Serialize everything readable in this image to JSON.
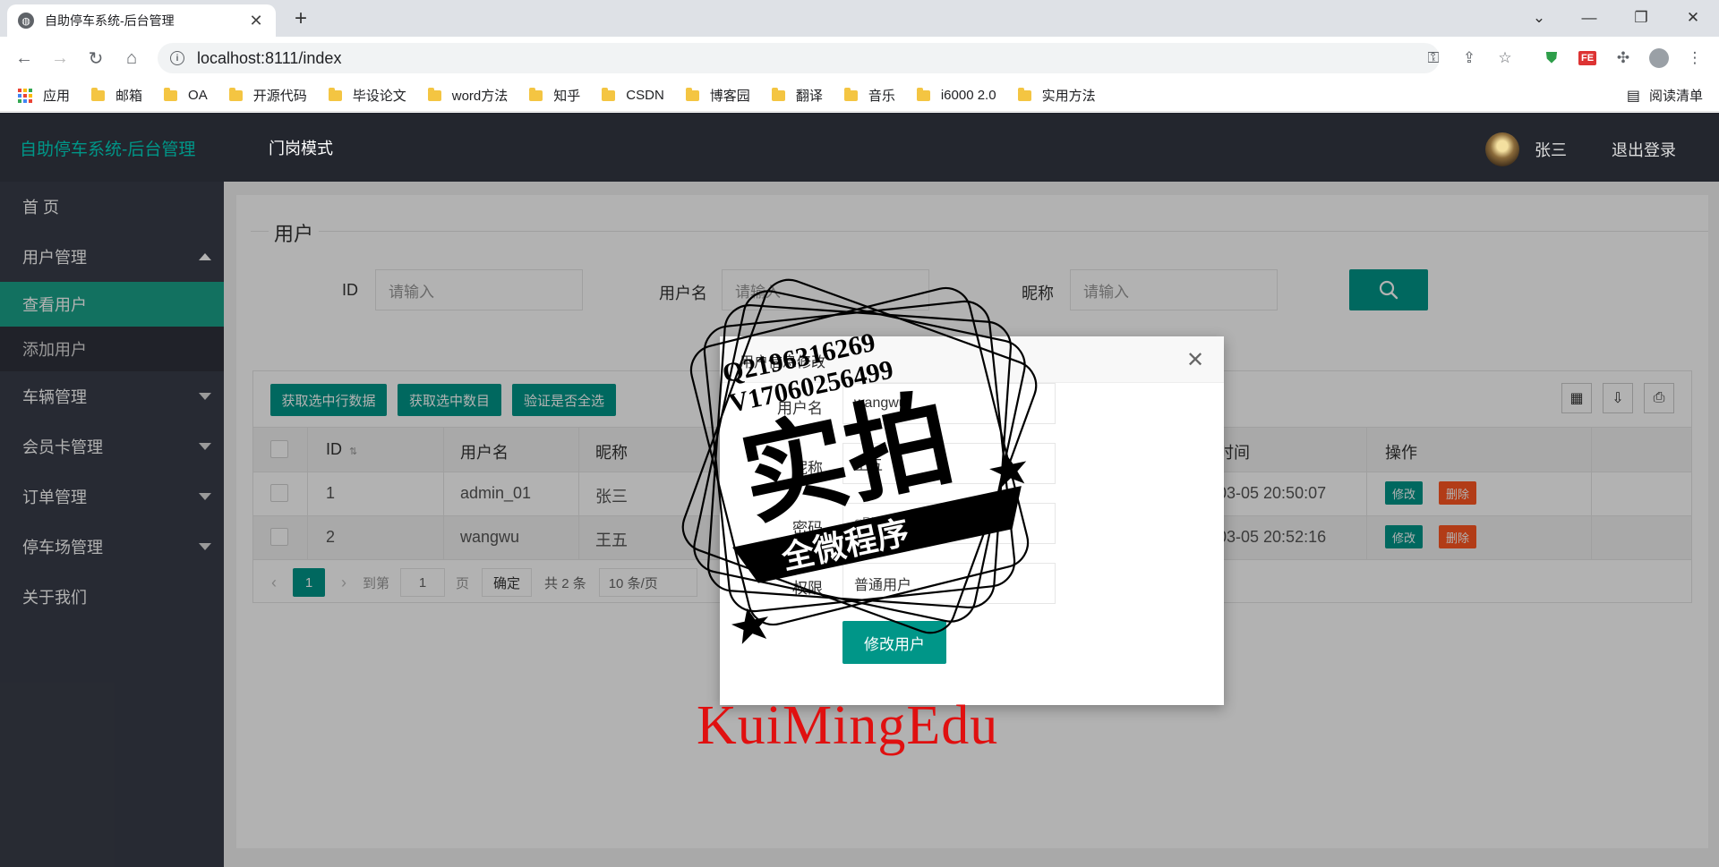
{
  "browser": {
    "tab_title": "自助停车系统-后台管理",
    "url": "localhost:8111/index",
    "bookmarks": [
      "应用",
      "邮箱",
      "OA",
      "开源代码",
      "毕设论文",
      "word方法",
      "知乎",
      "CSDN",
      "博客园",
      "翻译",
      "音乐",
      "i6000 2.0",
      "实用方法"
    ],
    "reading_list": "阅读清单"
  },
  "header": {
    "logo": "自助停车系统-后台管理",
    "mode": "门岗模式",
    "user": "张三",
    "logout": "退出登录"
  },
  "sidebar": {
    "items": [
      {
        "label": "首 页"
      },
      {
        "label": "用户管理"
      },
      {
        "label": "查看用户"
      },
      {
        "label": "添加用户"
      },
      {
        "label": "车辆管理"
      },
      {
        "label": "会员卡管理"
      },
      {
        "label": "订单管理"
      },
      {
        "label": "停车场管理"
      },
      {
        "label": "关于我们"
      }
    ]
  },
  "main": {
    "legend": "用户",
    "filters": {
      "id_label": "ID",
      "username_label": "用户名",
      "nickname_label": "昵称",
      "placeholder": "请输入"
    },
    "toolbar": {
      "btn1": "获取选中行数据",
      "btn2": "获取选中数目",
      "btn3": "验证是否全选"
    },
    "columns": {
      "id": "ID",
      "username": "用户名",
      "nickname": "昵称",
      "time": "时间",
      "ops": "操作"
    },
    "rows": [
      {
        "id": "1",
        "username": "admin_01",
        "nickname": "张三",
        "time": "03-05 20:50:07",
        "edit": "修改",
        "del": "删除"
      },
      {
        "id": "2",
        "username": "wangwu",
        "nickname": "王五",
        "time": "03-05 20:52:16",
        "edit": "修改",
        "del": "删除"
      }
    ],
    "pager": {
      "current": "1",
      "goto": "到第",
      "page_input": "1",
      "page_unit": "页",
      "confirm": "确定",
      "total": "共 2 条",
      "per_page": "10 条/页"
    }
  },
  "modal": {
    "title": "用户信息修改",
    "close": "✕",
    "fields": [
      {
        "label": "用户名",
        "value": "wangwu"
      },
      {
        "label": "昵称",
        "value": "王五"
      },
      {
        "label": "密码",
        "value": "gBWd...bdehBMV4vC"
      },
      {
        "label": "权限",
        "value": "普通用户"
      }
    ],
    "submit": "修改用户"
  },
  "watermark": {
    "q": "Q2196316269",
    "v": "V17060256499",
    "big": "实拍",
    "banner": "全微程序",
    "brand": "KuiMingEdu"
  }
}
